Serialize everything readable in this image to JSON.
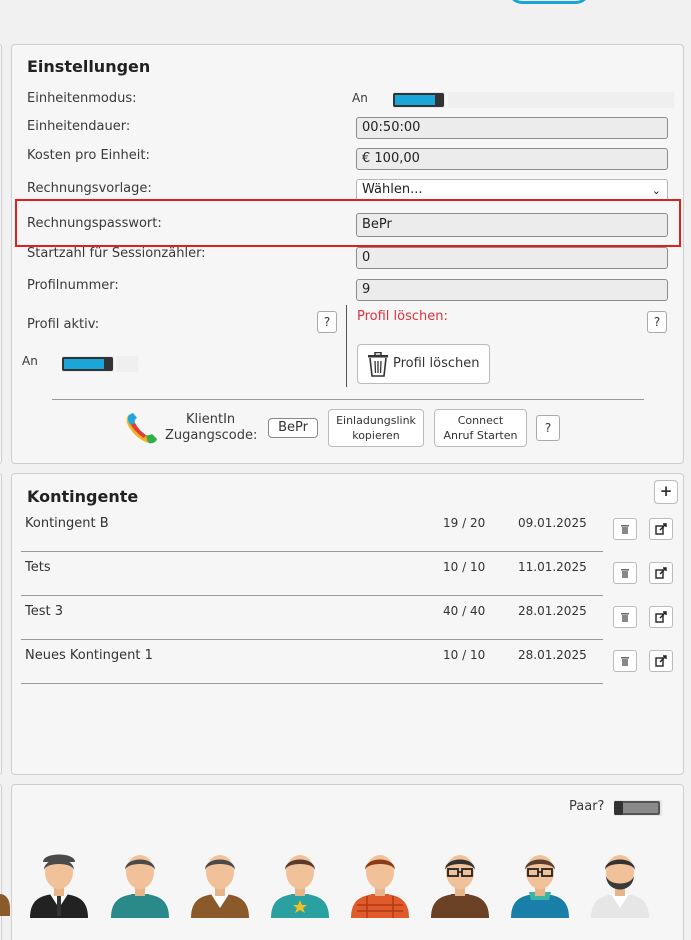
{
  "settings": {
    "title": "Einstellungen",
    "units_mode_label": "Einheitenmodus:",
    "units_mode_state": "An",
    "unit_duration_label": "Einheitendauer:",
    "unit_duration_value": "00:50:00",
    "cost_label": "Kosten pro Einheit:",
    "cost_value": "€ 100,00",
    "invoice_template_label": "Rechnungsvorlage:",
    "invoice_template_value": "Wählen...",
    "invoice_password_label": "Rechnungspasswort:",
    "invoice_password_value": "BePr",
    "session_counter_label": "Startzahl für Sessionzähler:",
    "session_counter_value": "0",
    "profile_number_label": "Profilnummer:",
    "profile_number_value": "9",
    "profile_active_label": "Profil aktiv:",
    "profile_active_state": "An",
    "help_label": "?",
    "delete_profile_heading": "Profil löschen:",
    "delete_profile_button": "Profil löschen",
    "client_label_line1": "KlientIn",
    "client_label_line2": "Zugangscode:",
    "client_code": "BePr",
    "invite_link_line1": "Einladungslink",
    "invite_link_line2": "kopieren",
    "connect_line1": "Connect",
    "connect_line2": "Anruf Starten"
  },
  "contingents": {
    "title": "Kontingente",
    "add_label": "+",
    "rows": [
      {
        "name": "Kontingent B",
        "count": "19 / 20",
        "date": "09.01.2025"
      },
      {
        "name": "Tets",
        "count": "10 / 10",
        "date": "11.01.2025"
      },
      {
        "name": "Test 3",
        "count": "40 / 40",
        "date": "28.01.2025"
      },
      {
        "name": "Neues Kontingent 1",
        "count": "10 / 10",
        "date": "28.01.2025"
      }
    ]
  },
  "avatars": {
    "pair_label": "Paar?"
  },
  "colors": {
    "accent": "#1aa6d8",
    "danger": "#e02020"
  }
}
